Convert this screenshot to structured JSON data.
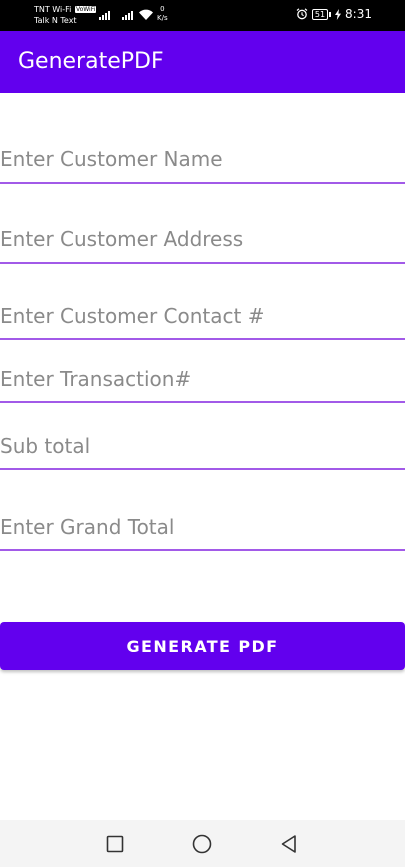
{
  "status_bar": {
    "carrier_line1": "TNT Wi-Fi",
    "wifi_badge": "VoWiFi",
    "carrier_line2": "Talk N Text",
    "speed_value": "0",
    "speed_unit": "K/s",
    "battery": "51",
    "time": "8:31"
  },
  "app_bar": {
    "title": "GeneratePDF"
  },
  "form": {
    "customer_name_placeholder": "Enter Customer Name",
    "customer_address_placeholder": "Enter Customer Address",
    "customer_contact_placeholder": "Enter Customer Contact #",
    "transaction_placeholder": "Enter Transaction#",
    "subtotal_placeholder": "Sub total",
    "grand_total_placeholder": "Enter Grand Total",
    "generate_label": "GENERATE PDF"
  },
  "icons": {
    "alarm": "alarm-clock-icon",
    "battery": "battery-icon",
    "charging": "charging-bolt-icon",
    "wifi": "wifi-icon",
    "signal": "signal-bars-icon",
    "nav_recent": "square-recent-apps-icon",
    "nav_home": "circle-home-icon",
    "nav_back": "triangle-back-icon"
  },
  "colors": {
    "primary": "#6200ee",
    "underline": "#a25ae8",
    "status_bar": "#000000",
    "nav_bar": "#f4f4f4"
  }
}
